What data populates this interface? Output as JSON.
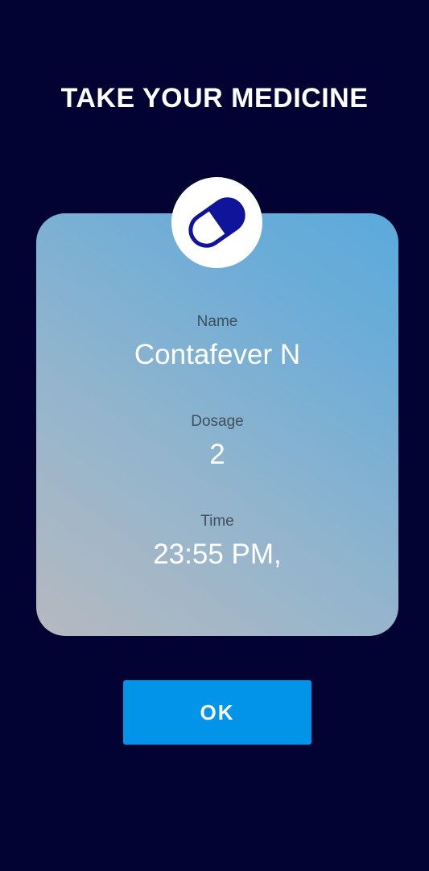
{
  "header": {
    "title": "TAKE YOUR MEDICINE"
  },
  "icon": {
    "name": "pill-icon",
    "color": "#0f149a"
  },
  "medicine": {
    "name_label": "Name",
    "name_value": "Contafever N",
    "dosage_label": "Dosage",
    "dosage_value": "2",
    "time_label": "Time",
    "time_value": "23:55 PM,"
  },
  "actions": {
    "ok_label": "OK"
  },
  "colors": {
    "background": "#020233",
    "button": "#0294e9",
    "card_gradient_start": "#b6b9c0",
    "card_gradient_end": "#5aaadc"
  }
}
